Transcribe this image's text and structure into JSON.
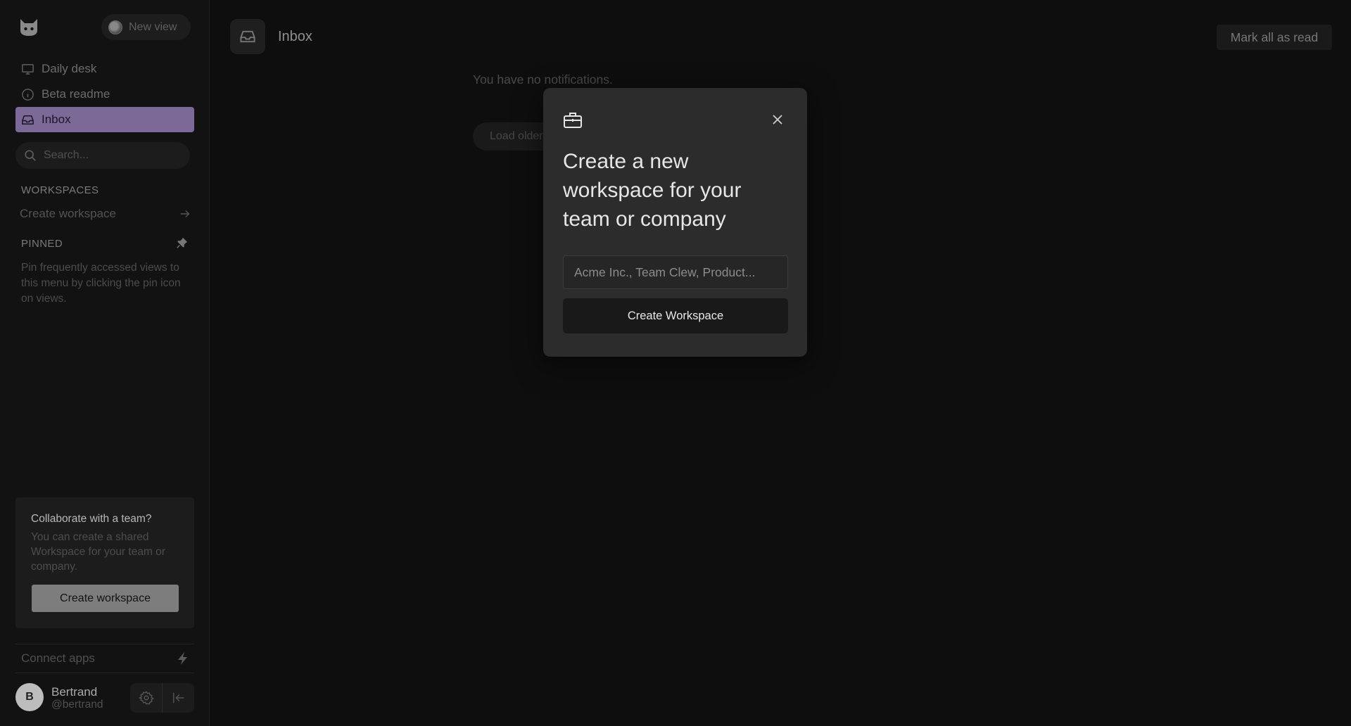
{
  "sidebar": {
    "new_view_label": "New view",
    "nav": [
      {
        "label": "Daily desk",
        "icon": "monitor-icon"
      },
      {
        "label": "Beta readme",
        "icon": "info-icon"
      },
      {
        "label": "Inbox",
        "icon": "inbox-icon",
        "active": true
      }
    ],
    "search_placeholder": "Search...",
    "workspaces_heading": "WORKSPACES",
    "create_workspace_link": "Create workspace",
    "pinned_heading": "PINNED",
    "pinned_help": "Pin frequently accessed views to this menu by clicking the pin icon on views.",
    "collab": {
      "title": "Collaborate with a team?",
      "body": "You can create a shared Workspace for your team or company.",
      "button": "Create workspace"
    },
    "connect_apps": "Connect apps",
    "user": {
      "initial": "B",
      "name": "Bertrand",
      "handle": "@bertrand"
    }
  },
  "main": {
    "title": "Inbox",
    "mark_all_read": "Mark all as read",
    "empty_text": "You have no notifications.",
    "load_older": "Load older"
  },
  "modal": {
    "title": "Create a new workspace for your team or company",
    "input_placeholder": "Acme Inc., Team Clew, Product...",
    "input_value": "",
    "submit_label": "Create Workspace"
  },
  "colors": {
    "active_nav": "#7d6997",
    "modal_bg": "#2c2c2c",
    "app_bg": "#0e0e0e"
  }
}
